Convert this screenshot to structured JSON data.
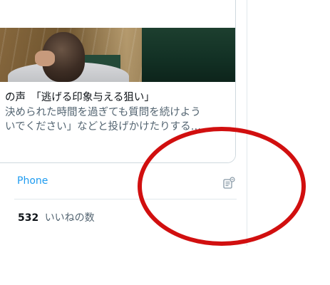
{
  "card": {
    "title": "の声　「逃げる印象与える狙い」",
    "desc_line1": "決められた時間を過ぎても質問を続けよう",
    "desc_line2": "いでください」などと投げかけたりする…"
  },
  "meta": {
    "source": "Phone",
    "source_color": "#1d9bf0"
  },
  "stats": {
    "likes_count": "532",
    "likes_label": "いいねの数"
  },
  "icons": {
    "tweet_options": "tweet-activity-icon"
  },
  "colors": {
    "annotation_circle": "#d10f0f",
    "border": "#cfd9de",
    "secondary_text": "#536471"
  }
}
